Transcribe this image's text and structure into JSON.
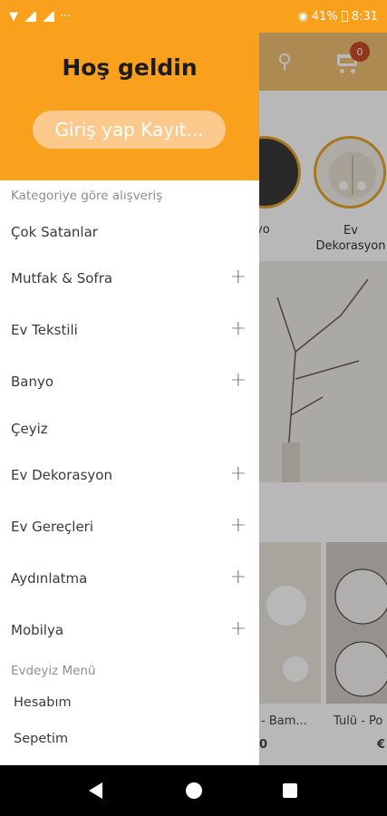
{
  "status_bar": {
    "left_icons": "···",
    "battery_text": "41%",
    "time": "8:31"
  },
  "background": {
    "cart_badge": "0",
    "category_labels": [
      "yo",
      "Ev\nDekorasyon"
    ],
    "product_names": [
      "- Bam...",
      "Tulü - Po"
    ],
    "product_prices": [
      "0",
      "€"
    ]
  },
  "drawer": {
    "welcome": "Hoş geldin",
    "login_button": "Giriş yap Kayıt...",
    "section_categories": "Kategoriye göre alışveriş",
    "menu_items": [
      {
        "label": "Çok Satanlar",
        "expand": ""
      },
      {
        "label": "Mutfak & Sofra",
        "expand": "+"
      },
      {
        "label": "Ev Tekstili",
        "expand": "+"
      },
      {
        "label": "Banyo",
        "expand": "+"
      },
      {
        "label": "Çeyiz",
        "expand": ""
      },
      {
        "label": "Ev Dekorasyon",
        "expand": "+"
      },
      {
        "label": "Ev Gereçleri",
        "expand": "+"
      },
      {
        "label": "Aydınlatma",
        "expand": "+"
      },
      {
        "label": "Mobilya",
        "expand": "+"
      }
    ],
    "section_menu": "Evdeyiz Menü",
    "sub_items": [
      "Hesabım",
      "Sepetim"
    ]
  },
  "colors": {
    "accent": "#f9a01c",
    "badge": "#c94a28"
  }
}
